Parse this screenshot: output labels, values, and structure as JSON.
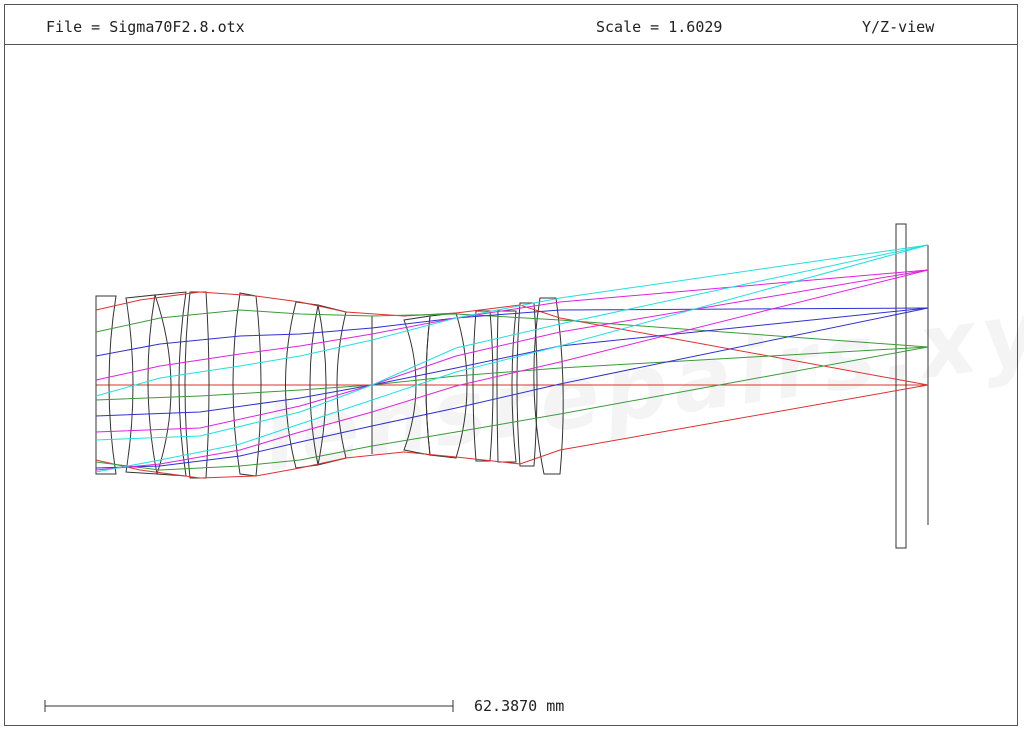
{
  "header": {
    "file_label": "File = Sigma70F2.8.otx",
    "scale_label": "Scale = 1.6029",
    "view_label": "Y/Z-view"
  },
  "scale_bar": {
    "length_label": "62.3870 mm"
  },
  "watermark": {
    "text": "lensrepairs.xyz"
  },
  "colors": {
    "lens_outline": "#333333",
    "ray_axial": "#e03030",
    "ray_green": "#3a9a3a",
    "ray_blue": "#3030d0",
    "ray_magenta": "#e020e0",
    "ray_cyan": "#20e0e0"
  }
}
